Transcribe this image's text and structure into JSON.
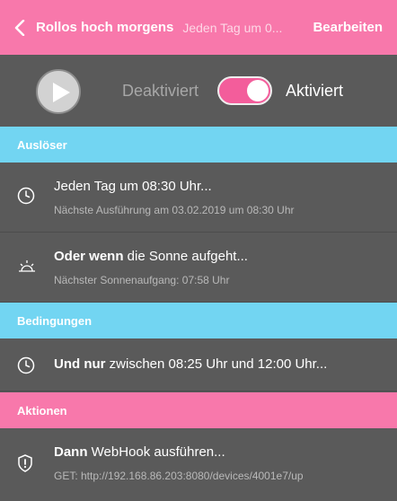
{
  "header": {
    "back_icon": "chevron-left-icon",
    "title": "Rollos hoch morgens",
    "subtitle": "Jeden Tag um 0...",
    "edit_label": "Bearbeiten",
    "accent": "#f878ab"
  },
  "controls": {
    "play_icon": "play-icon",
    "label_off": "Deaktiviert",
    "label_on": "Aktiviert",
    "toggle_on": true
  },
  "sections": {
    "triggers": {
      "title": "Auslöser",
      "color": "#72d5f2"
    },
    "conditions": {
      "title": "Bedingungen",
      "color": "#72d5f2"
    },
    "actions": {
      "title": "Aktionen",
      "color": "#f878ab"
    }
  },
  "triggers": [
    {
      "icon": "clock-icon",
      "bold": "",
      "text": "Jeden Tag um 08:30 Uhr...",
      "detail": "Nächste Ausführung am 03.02.2019 um 08:30 Uhr"
    },
    {
      "icon": "sunrise-icon",
      "bold": "Oder wenn",
      "text": " die Sonne aufgeht...",
      "detail": "Nächster Sonnenaufgang: 07:58 Uhr"
    }
  ],
  "conditions": [
    {
      "icon": "clock-icon",
      "bold": "Und nur",
      "text": " zwischen 08:25 Uhr und 12:00 Uhr..."
    }
  ],
  "actions": [
    {
      "icon": "shield-alert-icon",
      "bold": "Dann",
      "text": " WebHook ausführen...",
      "detail": "GET: http://192.168.86.203:8080/devices/4001e7/up"
    }
  ]
}
